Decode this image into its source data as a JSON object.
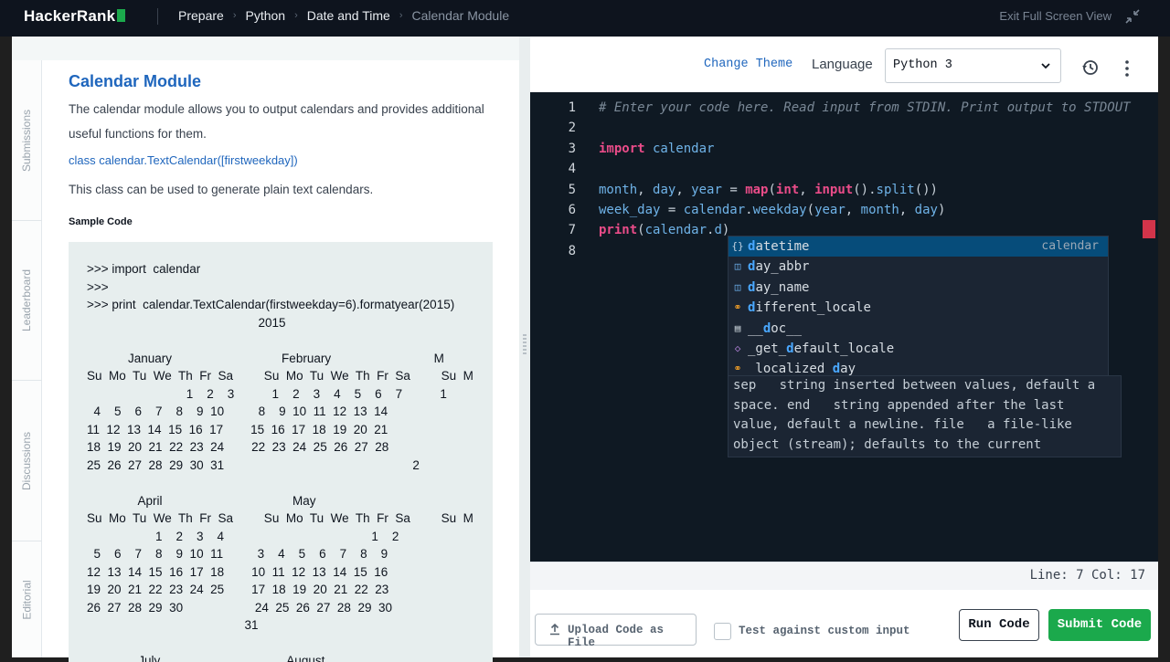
{
  "topbar": {
    "logo": "HackerRank",
    "breadcrumbs": [
      "Prepare",
      "Python",
      "Date and Time",
      "Calendar Module"
    ],
    "exit_fullscreen": "Exit Full Screen View"
  },
  "sidebar": {
    "tabs": [
      "Submissions",
      "Leaderboard",
      "Discussions",
      "Editorial"
    ]
  },
  "problem": {
    "title": "Calendar Module",
    "description": "The calendar module allows you to output calendars and provides additional useful functions for them.",
    "class_link": "class calendar.TextCalendar([firstweekday])",
    "class_description": "This class can be used to generate plain text calendars.",
    "sample_heading": "Sample Code",
    "sample_code": ">>> import  calendar\n>>>\n>>> print  calendar.TextCalendar(firstweekday=6).formatyear(2015)\n                                                  2015\n\n            January                                February                              M\nSu  Mo  Tu  We  Th  Fr  Sa         Su  Mo  Tu  We  Th  Fr  Sa         Su  M\n                             1    2    3           1    2    3    4    5    6    7           1\n  4    5    6    7    8    9  10          8    9  10  11  12  13  14\n11  12  13  14  15  16  17        15  16  17  18  19  20  21\n18  19  20  21  22  23  24        22  23  24  25  26  27  28\n25  26  27  28  29  30  31                                                       2\n\n               April                                      May\nSu  Mo  Tu  We  Th  Fr  Sa         Su  Mo  Tu  We  Th  Fr  Sa         Su  M\n                    1    2    3    4                                           1    2\n  5    6    7    8    9  10  11          3    4    5    6    7    8    9\n12  13  14  15  16  17  18        10  11  12  13  14  15  16\n19  20  21  22  23  24  25        17  18  19  20  21  22  23\n26  27  28  29  30                     24  25  26  27  28  29  30\n                                              31\n\n               July                                     August"
  },
  "editor": {
    "change_theme": "Change Theme",
    "language_label": "Language",
    "language_value": "Python 3",
    "code_lines": [
      {
        "n": "1",
        "parts": [
          {
            "c": "cmt",
            "t": "# Enter your code here. Read input from STDIN. Print output to STDOUT"
          }
        ]
      },
      {
        "n": "2",
        "parts": []
      },
      {
        "n": "3",
        "parts": [
          {
            "c": "kw",
            "t": "import"
          },
          {
            "c": "pl",
            "t": " calendar"
          }
        ]
      },
      {
        "n": "4",
        "parts": []
      },
      {
        "n": "5",
        "parts": [
          {
            "c": "pl",
            "t": "month"
          },
          {
            "c": "op",
            "t": ", "
          },
          {
            "c": "pl",
            "t": "day"
          },
          {
            "c": "op",
            "t": ", "
          },
          {
            "c": "pl",
            "t": "year"
          },
          {
            "c": "op",
            "t": " = "
          },
          {
            "c": "fn",
            "t": "map"
          },
          {
            "c": "op",
            "t": "("
          },
          {
            "c": "fn",
            "t": "int"
          },
          {
            "c": "op",
            "t": ", "
          },
          {
            "c": "fn",
            "t": "input"
          },
          {
            "c": "op",
            "t": "()."
          },
          {
            "c": "pl",
            "t": "split"
          },
          {
            "c": "op",
            "t": "())"
          }
        ]
      },
      {
        "n": "6",
        "parts": [
          {
            "c": "pl",
            "t": "week_day"
          },
          {
            "c": "op",
            "t": " = "
          },
          {
            "c": "pl",
            "t": "calendar"
          },
          {
            "c": "op",
            "t": "."
          },
          {
            "c": "pl",
            "t": "weekday"
          },
          {
            "c": "op",
            "t": "("
          },
          {
            "c": "pl",
            "t": "year"
          },
          {
            "c": "op",
            "t": ", "
          },
          {
            "c": "pl",
            "t": "month"
          },
          {
            "c": "op",
            "t": ", "
          },
          {
            "c": "pl",
            "t": "day"
          },
          {
            "c": "op",
            "t": ")"
          }
        ]
      },
      {
        "n": "7",
        "parts": [
          {
            "c": "fn",
            "t": "print"
          },
          {
            "c": "op",
            "t": "("
          },
          {
            "c": "pl",
            "t": "calendar"
          },
          {
            "c": "op",
            "t": "."
          },
          {
            "c": "pl",
            "t": "d"
          },
          {
            "c": "op",
            "t": ")"
          }
        ]
      },
      {
        "n": "8",
        "parts": []
      }
    ],
    "suggestions": [
      {
        "icon": "module-icon",
        "glyph": "{}",
        "pre": "",
        "hl": "d",
        "rest": "atetime",
        "detail": "calendar",
        "selected": true
      },
      {
        "icon": "variable-icon",
        "glyph": "◫",
        "pre": "",
        "hl": "d",
        "rest": "ay_abbr",
        "detail": "",
        "selected": false
      },
      {
        "icon": "variable-icon",
        "glyph": "◫",
        "pre": "",
        "hl": "d",
        "rest": "ay_name",
        "detail": "",
        "selected": false
      },
      {
        "icon": "class-icon",
        "glyph": "⚭",
        "pre": "",
        "hl": "d",
        "rest": "ifferent_locale",
        "detail": "",
        "selected": false
      },
      {
        "icon": "text-icon",
        "glyph": "▤",
        "pre": "__",
        "hl": "d",
        "rest": "oc__",
        "detail": "",
        "selected": false
      },
      {
        "icon": "method-icon",
        "glyph": "◇",
        "pre": "_get_",
        "hl": "d",
        "rest": "efault_locale",
        "detail": "",
        "selected": false
      },
      {
        "icon": "class-icon",
        "glyph": "⚭",
        "pre": "_localized_",
        "hl": "d",
        "rest": "ay",
        "detail": "",
        "selected": false
      }
    ],
    "doc_text": "sep   string inserted between values, default a\nspace. end   string appended after the last\nvalue, default a newline. file   a file-like\nobject (stream); defaults to the current",
    "status": "Line: 7 Col: 17"
  },
  "actions": {
    "upload": "Upload Code as File",
    "custom_input": "Test against custom input",
    "run": "Run Code",
    "submit": "Submit Code"
  },
  "colors": {
    "accent_green": "#1ba94c",
    "link_blue": "#1f66bd",
    "editor_bg": "#0f1923",
    "topbar_bg": "#0e141e"
  }
}
